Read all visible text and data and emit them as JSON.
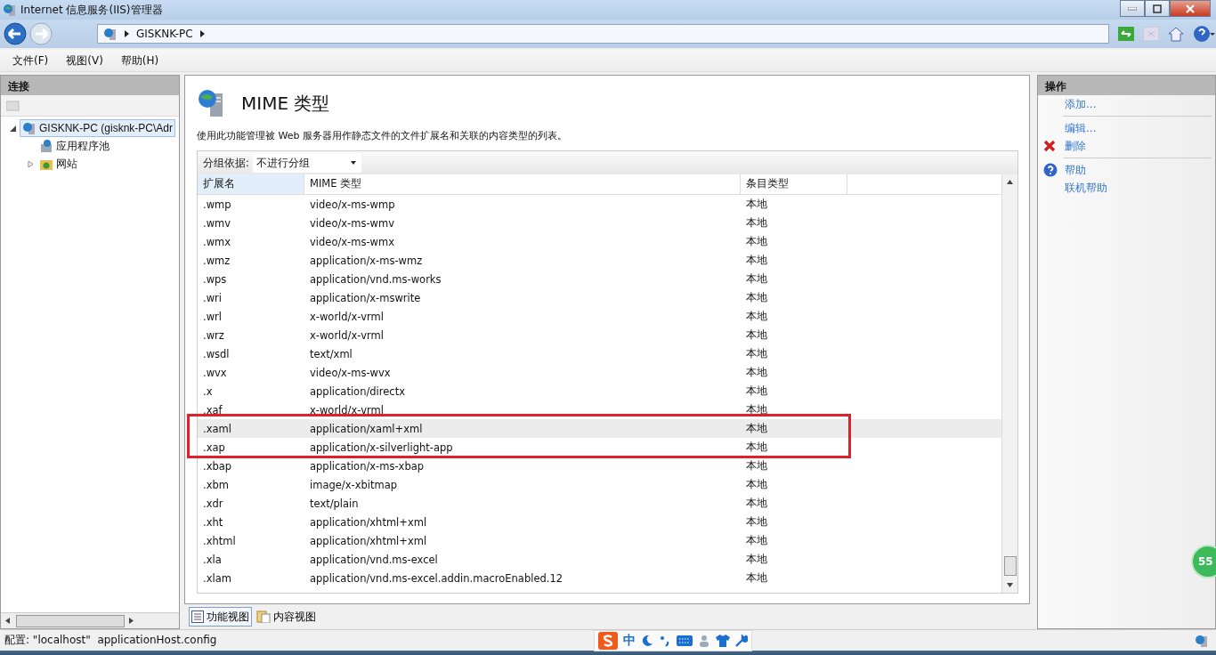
{
  "window": {
    "title": "Internet 信息服务(IIS)管理器"
  },
  "address": {
    "crumbs": [
      "GISKNK-PC"
    ]
  },
  "menu": [
    "文件(F)",
    "视图(V)",
    "帮助(H)"
  ],
  "connections": {
    "title": "连接",
    "tree": [
      {
        "label": "GISKNK-PC (gisknk-PC\\Adr",
        "kind": "server",
        "expanded": true,
        "selected": true,
        "children": [
          {
            "label": "应用程序池",
            "kind": "pool"
          },
          {
            "label": "网站",
            "kind": "sites",
            "expanded": false
          }
        ]
      }
    ]
  },
  "feature": {
    "title": "MIME 类型",
    "description": "使用此功能管理被 Web 服务器用作静态文件的文件扩展名和关联的内容类型的列表。",
    "group_label": "分组依据:",
    "group_value": "不进行分组"
  },
  "table": {
    "columns": [
      "扩展名",
      "MIME 类型",
      "条目类型"
    ],
    "rows": [
      {
        "cells": [
          ".wmp",
          "video/x-ms-wmp",
          "本地"
        ],
        "selected": false,
        "highlighted": false
      },
      {
        "cells": [
          ".wmv",
          "video/x-ms-wmv",
          "本地"
        ],
        "selected": false,
        "highlighted": false
      },
      {
        "cells": [
          ".wmx",
          "video/x-ms-wmx",
          "本地"
        ],
        "selected": false,
        "highlighted": false
      },
      {
        "cells": [
          ".wmz",
          "application/x-ms-wmz",
          "本地"
        ],
        "selected": false,
        "highlighted": false
      },
      {
        "cells": [
          ".wps",
          "application/vnd.ms-works",
          "本地"
        ],
        "selected": false,
        "highlighted": false
      },
      {
        "cells": [
          ".wri",
          "application/x-mswrite",
          "本地"
        ],
        "selected": false,
        "highlighted": false
      },
      {
        "cells": [
          ".wrl",
          "x-world/x-vrml",
          "本地"
        ],
        "selected": false,
        "highlighted": false
      },
      {
        "cells": [
          ".wrz",
          "x-world/x-vrml",
          "本地"
        ],
        "selected": false,
        "highlighted": false
      },
      {
        "cells": [
          ".wsdl",
          "text/xml",
          "本地"
        ],
        "selected": false,
        "highlighted": false
      },
      {
        "cells": [
          ".wvx",
          "video/x-ms-wvx",
          "本地"
        ],
        "selected": false,
        "highlighted": false
      },
      {
        "cells": [
          ".x",
          "application/directx",
          "本地"
        ],
        "selected": false,
        "highlighted": false
      },
      {
        "cells": [
          ".xaf",
          "x-world/x-vrml",
          "本地"
        ],
        "selected": false,
        "highlighted": false
      },
      {
        "cells": [
          ".xaml",
          "application/xaml+xml",
          "本地"
        ],
        "selected": true,
        "highlighted": true
      },
      {
        "cells": [
          ".xap",
          "application/x-silverlight-app",
          "本地"
        ],
        "selected": false,
        "highlighted": true
      },
      {
        "cells": [
          ".xbap",
          "application/x-ms-xbap",
          "本地"
        ],
        "selected": false,
        "highlighted": false
      },
      {
        "cells": [
          ".xbm",
          "image/x-xbitmap",
          "本地"
        ],
        "selected": false,
        "highlighted": false
      },
      {
        "cells": [
          ".xdr",
          "text/plain",
          "本地"
        ],
        "selected": false,
        "highlighted": false
      },
      {
        "cells": [
          ".xht",
          "application/xhtml+xml",
          "本地"
        ],
        "selected": false,
        "highlighted": false
      },
      {
        "cells": [
          ".xhtml",
          "application/xhtml+xml",
          "本地"
        ],
        "selected": false,
        "highlighted": false
      },
      {
        "cells": [
          ".xla",
          "application/vnd.ms-excel",
          "本地"
        ],
        "selected": false,
        "highlighted": false
      },
      {
        "cells": [
          ".xlam",
          "application/vnd.ms-excel.addin.macroEnabled.12",
          "本地"
        ],
        "selected": false,
        "highlighted": false
      }
    ]
  },
  "view_tabs": [
    {
      "label": "功能视图",
      "selected": true
    },
    {
      "label": "内容视图",
      "selected": false
    }
  ],
  "actions": {
    "title": "操作",
    "groups": [
      [
        {
          "label": "添加...",
          "kind": "none"
        }
      ],
      [
        {
          "label": "编辑...",
          "kind": "none"
        },
        {
          "label": "删除",
          "kind": "delete"
        }
      ],
      [
        {
          "label": "帮助",
          "kind": "help"
        },
        {
          "label": "联机帮助",
          "kind": "none"
        }
      ]
    ]
  },
  "status_bar": {
    "text": "配置: \"localhost\"  applicationHost.config"
  },
  "ime": {
    "mode": "中"
  },
  "badge": {
    "text": "55"
  }
}
